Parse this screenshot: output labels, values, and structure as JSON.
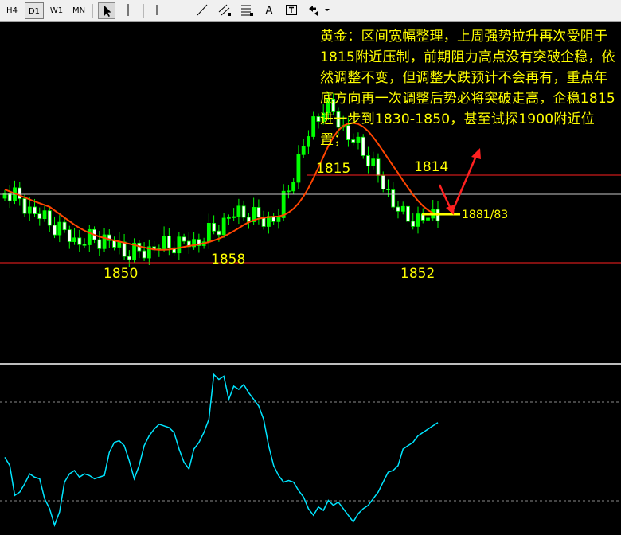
{
  "toolbar": {
    "timeframes": [
      {
        "label": "H4",
        "active": false
      },
      {
        "label": "D1",
        "active": true
      },
      {
        "label": "W1",
        "active": false
      },
      {
        "label": "MN",
        "active": false
      }
    ],
    "tools": [
      "cursor-icon",
      "crosshair-icon",
      "vertical-line-icon",
      "horizontal-line-icon",
      "trendline-icon",
      "equidistant-channel-icon",
      "fibonacci-icon",
      "text-icon",
      "text-label-icon",
      "arrows-icon"
    ],
    "text_tool_label": "A"
  },
  "colors": {
    "background": "#000000",
    "bull_candle": "#00ff00",
    "bear_candle": "#ffffff",
    "ma_line": "#ff4500",
    "indicator_line": "#00e5ff",
    "annotation": "#ffff00",
    "resistance_line": "#ff2020",
    "arrow": "#ff2020"
  },
  "annotations": {
    "comment": "黄金：区间宽幅整理，上周强势拉升再次受阻于1815附近压制，前期阻力高点没有突破企稳，依然调整不变，但调整大跌预计不会再有，重点年底方向再一次调整后势必将突破走高，企稳1815进一步到1830-1850，甚至试探1900附近位置；",
    "labels": [
      {
        "text": "1815"
      },
      {
        "text": "1814"
      },
      {
        "text": "1850"
      },
      {
        "text": "1858"
      },
      {
        "text": "1852"
      },
      {
        "text": "1881/83"
      }
    ]
  },
  "chart_data": {
    "type": "candlestick",
    "candle_count": 88,
    "indicator": {
      "type": "line",
      "values": [
        45,
        40,
        22,
        24,
        29,
        35,
        33,
        32,
        20,
        14,
        4,
        12,
        30,
        35,
        37,
        33,
        35,
        34,
        32,
        33,
        34,
        48,
        54,
        55,
        52,
        43,
        32,
        40,
        52,
        58,
        62,
        65,
        64,
        63,
        60,
        50,
        42,
        38,
        50,
        54,
        60,
        68,
        95,
        92,
        94,
        80,
        88,
        86,
        89,
        84,
        80,
        76,
        68,
        52,
        40,
        34,
        30,
        31,
        30,
        25,
        21,
        14,
        10,
        15,
        13,
        19,
        16,
        18,
        14,
        10,
        6,
        11,
        14,
        16,
        20,
        24,
        30,
        36,
        37,
        40,
        50,
        52,
        54,
        58,
        60,
        62,
        64,
        66
      ],
      "reference_levels": [
        70,
        18
      ]
    }
  }
}
